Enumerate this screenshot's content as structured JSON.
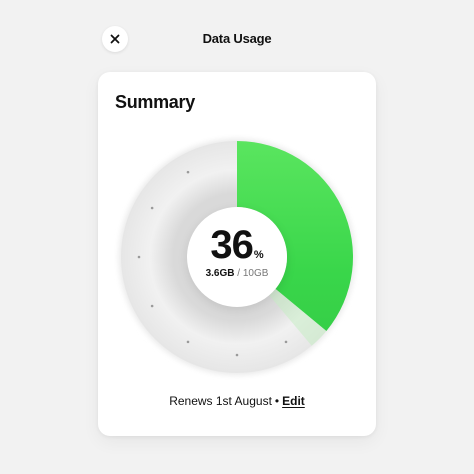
{
  "header": {
    "title": "Data Usage",
    "close_icon": "close-icon"
  },
  "summary": {
    "title": "Summary",
    "usage_percent": 36,
    "percent_value": "36",
    "percent_unit": "%",
    "used": "3.6GB",
    "separator": "/",
    "total": "10GB",
    "renews_text": "Renews 1st August",
    "bullet": "•",
    "edit_label": "Edit"
  },
  "colors": {
    "background": "#f2f2f2",
    "card": "#ffffff",
    "accent_green": "#3ddc4e",
    "track": "#ededed"
  }
}
